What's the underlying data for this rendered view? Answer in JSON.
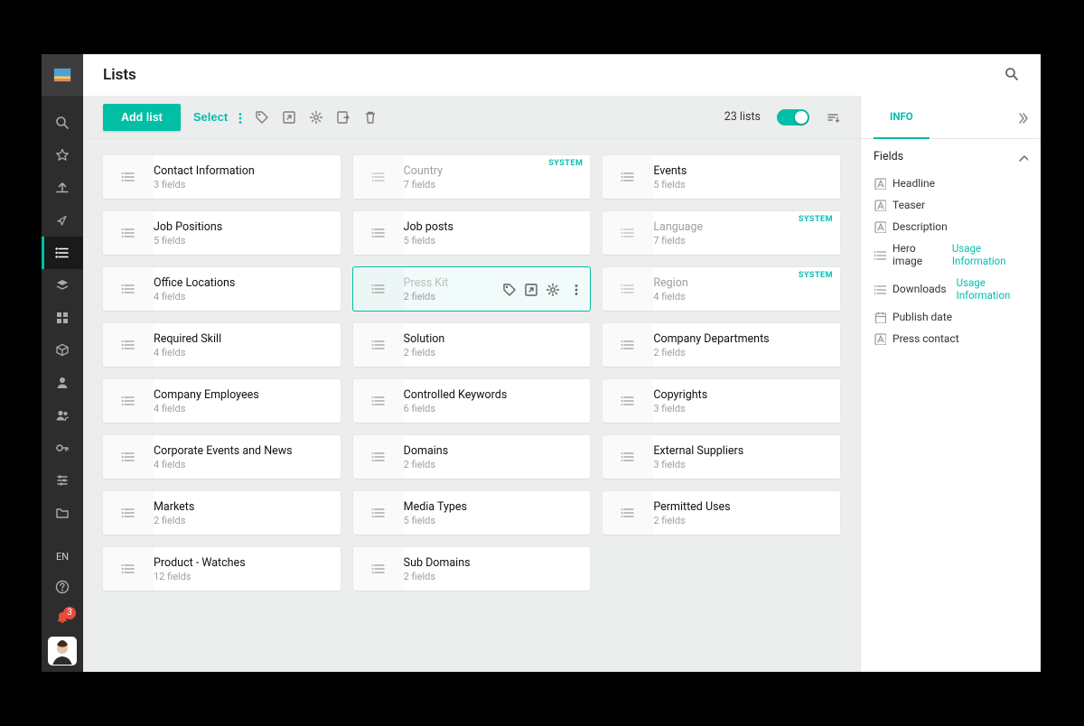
{
  "header": {
    "title": "Lists",
    "count_label": "23 lists"
  },
  "toolbar": {
    "add_label": "Add list",
    "select_label": "Select"
  },
  "cards": [
    {
      "name": "Contact Information",
      "fields": "3 fields"
    },
    {
      "name": "Country",
      "fields": "7 fields",
      "system": true
    },
    {
      "name": "Events",
      "fields": "5 fields"
    },
    {
      "name": "Job Positions",
      "fields": "5 fields"
    },
    {
      "name": "Job posts",
      "fields": "5 fields"
    },
    {
      "name": "Language",
      "fields": "7 fields",
      "system": true
    },
    {
      "name": "Office Locations",
      "fields": "4 fields"
    },
    {
      "name": "Press Kit",
      "fields": "2 fields",
      "selected": true
    },
    {
      "name": "Region",
      "fields": "4 fields",
      "system": true
    },
    {
      "name": "Required Skill",
      "fields": "4 fields"
    },
    {
      "name": "Solution",
      "fields": "2 fields"
    },
    {
      "name": "Company Departments",
      "fields": "2 fields"
    },
    {
      "name": "Company Employees",
      "fields": "4 fields"
    },
    {
      "name": "Controlled Keywords",
      "fields": "6 fields"
    },
    {
      "name": "Copyrights",
      "fields": "3 fields"
    },
    {
      "name": "Corporate Events and News",
      "fields": "4 fields"
    },
    {
      "name": "Domains",
      "fields": "2 fields"
    },
    {
      "name": "External Suppliers",
      "fields": "3 fields"
    },
    {
      "name": "Markets",
      "fields": "2 fields"
    },
    {
      "name": "Media Types",
      "fields": "5 fields"
    },
    {
      "name": "Permitted Uses",
      "fields": "2 fields"
    },
    {
      "name": "Product - Watches",
      "fields": "12 fields"
    },
    {
      "name": "Sub Domains",
      "fields": "2 fields"
    }
  ],
  "tag_system": "SYSTEM",
  "aside": {
    "tab": "INFO",
    "section": "Fields",
    "fields": [
      {
        "type": "text",
        "label": "Headline"
      },
      {
        "type": "text",
        "label": "Teaser"
      },
      {
        "type": "text",
        "label": "Description"
      },
      {
        "type": "list",
        "label": "Hero image",
        "usage": "Usage Information"
      },
      {
        "type": "list",
        "label": "Downloads",
        "usage": "Usage Information"
      },
      {
        "type": "date",
        "label": "Publish date"
      },
      {
        "type": "text",
        "label": "Press contact"
      }
    ]
  },
  "sidebar": {
    "lang": "EN",
    "badge": "3"
  }
}
